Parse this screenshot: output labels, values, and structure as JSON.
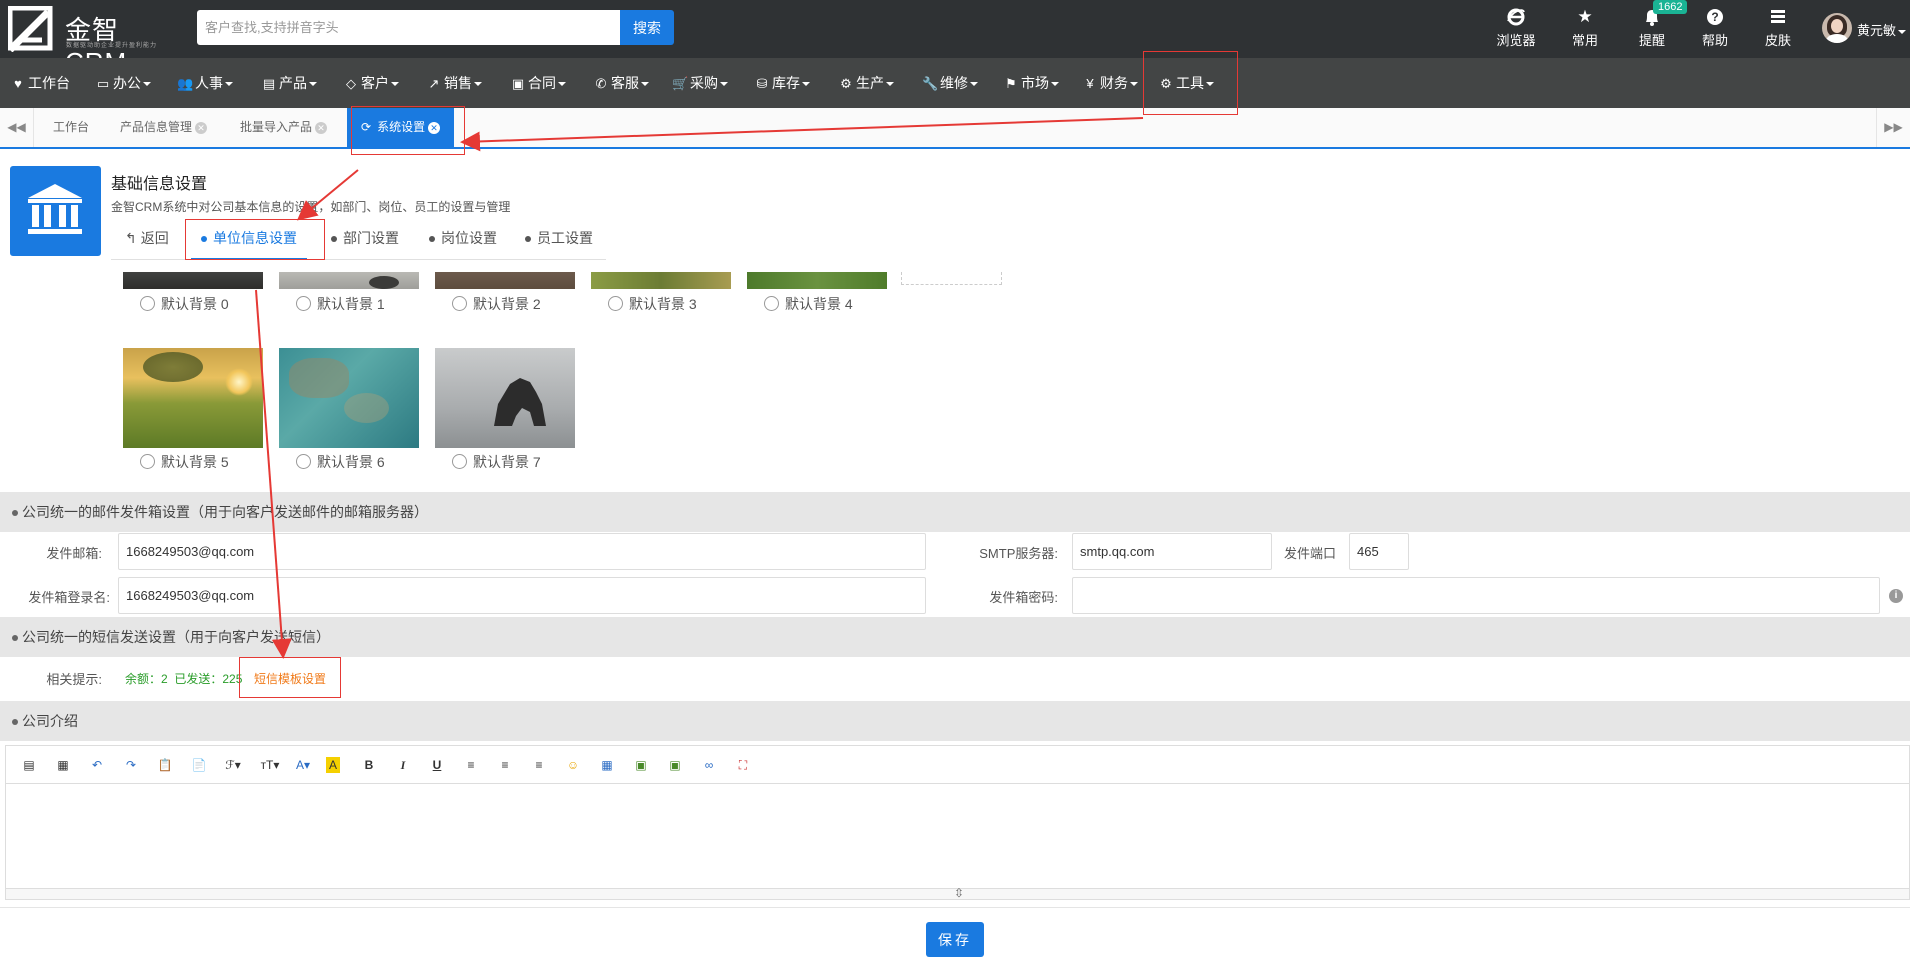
{
  "header": {
    "logo_text": "金智CRM",
    "logo_sub": "数据驱动助企业提升盈利能力",
    "search_placeholder": "客户查找,支持拼音字头",
    "search_button": "搜索",
    "icons": [
      {
        "name": "browser-icon",
        "glyph": "e",
        "label": "浏览器"
      },
      {
        "name": "star-icon",
        "glyph": "★",
        "label": "常用"
      },
      {
        "name": "bell-icon",
        "glyph": "🔔",
        "label": "提醒"
      },
      {
        "name": "help-icon",
        "glyph": "?",
        "label": "帮助"
      },
      {
        "name": "skin-icon",
        "glyph": "≡",
        "label": "皮肤"
      }
    ],
    "reminder_badge": "1662",
    "user_name": "黄元敏"
  },
  "menu": [
    {
      "name": "menu-workbench",
      "icon": "♥",
      "label": "工作台",
      "caret": false
    },
    {
      "name": "menu-office",
      "icon": "▭",
      "label": "办公",
      "caret": true
    },
    {
      "name": "menu-hr",
      "icon": "👥",
      "label": "人事",
      "caret": true
    },
    {
      "name": "menu-product",
      "icon": "▤",
      "label": "产品",
      "caret": true
    },
    {
      "name": "menu-customer",
      "icon": "◇",
      "label": "客户",
      "caret": true
    },
    {
      "name": "menu-sales",
      "icon": "↗",
      "label": "销售",
      "caret": true
    },
    {
      "name": "menu-contract",
      "icon": "▣",
      "label": "合同",
      "caret": true
    },
    {
      "name": "menu-service",
      "icon": "✆",
      "label": "客服",
      "caret": true
    },
    {
      "name": "menu-purchase",
      "icon": "🛒",
      "label": "采购",
      "caret": true
    },
    {
      "name": "menu-inventory",
      "icon": "⛁",
      "label": "库存",
      "caret": true
    },
    {
      "name": "menu-production",
      "icon": "⚙",
      "label": "生产",
      "caret": true
    },
    {
      "name": "menu-repair",
      "icon": "🔧",
      "label": "维修",
      "caret": true
    },
    {
      "name": "menu-market",
      "icon": "⚑",
      "label": "市场",
      "caret": true
    },
    {
      "name": "menu-finance",
      "icon": "¥",
      "label": "财务",
      "caret": true
    },
    {
      "name": "menu-tools",
      "icon": "⚙",
      "label": "工具",
      "caret": true
    }
  ],
  "tabs": [
    {
      "label": "工作台",
      "closable": false,
      "active": false
    },
    {
      "label": "产品信息管理",
      "closable": true,
      "active": false
    },
    {
      "label": "批量导入产品",
      "closable": true,
      "active": false
    },
    {
      "label": "系统设置",
      "closable": true,
      "active": true
    }
  ],
  "page": {
    "title": "基础信息设置",
    "description": "金智CRM系统中对公司基本信息的设置，如部门、岗位、员工的设置与管理",
    "back": "返回",
    "subnav": [
      "单位信息设置",
      "部门设置",
      "岗位设置",
      "员工设置"
    ],
    "active_subnav": "单位信息设置"
  },
  "backgrounds": [
    "默认背景 0",
    "默认背景 1",
    "默认背景 2",
    "默认背景 3",
    "默认背景 4",
    "默认背景 5",
    "默认背景 6",
    "默认背景 7"
  ],
  "mail": {
    "section_title": "公司统一的邮件发件箱设置（用于向客户发送邮件的邮箱服务器）",
    "sender_label": "发件邮箱:",
    "sender_value": "1668249503@qq.com",
    "smtp_label": "SMTP服务器:",
    "smtp_value": "smtp.qq.com",
    "port_label": "发件端口",
    "port_value": "465",
    "login_label": "发件箱登录名:",
    "login_value": "1668249503@qq.com",
    "password_label": "发件箱密码:",
    "password_value": ""
  },
  "sms": {
    "section_title": "公司统一的短信发送设置（用于向客户发送短信）",
    "hint_label": "相关提示:",
    "balance_text": "余额：2  已发送：225",
    "template_link": "短信模板设置"
  },
  "intro": {
    "section_title": "公司介绍"
  },
  "editor_toolbar": [
    "source-icon",
    "template-icon",
    "undo-icon",
    "redo-icon",
    "paste-icon",
    "paste-word-icon",
    "font-family-icon",
    "font-size-icon",
    "font-color-icon",
    "highlight-icon",
    "bold-icon",
    "italic-icon",
    "underline-icon",
    "align-left-icon",
    "align-center-icon",
    "align-right-icon",
    "emoji-icon",
    "table-icon",
    "image-icon",
    "multi-image-icon",
    "link-icon",
    "fullscreen-icon"
  ],
  "save_button": "保存",
  "colors": {
    "topbar": "#2f3234",
    "menubar": "#434545",
    "accent": "#1a7ae0",
    "annotation": "#e53935",
    "sms_green": "#2a9d2a",
    "link_orange": "#f07a19"
  }
}
